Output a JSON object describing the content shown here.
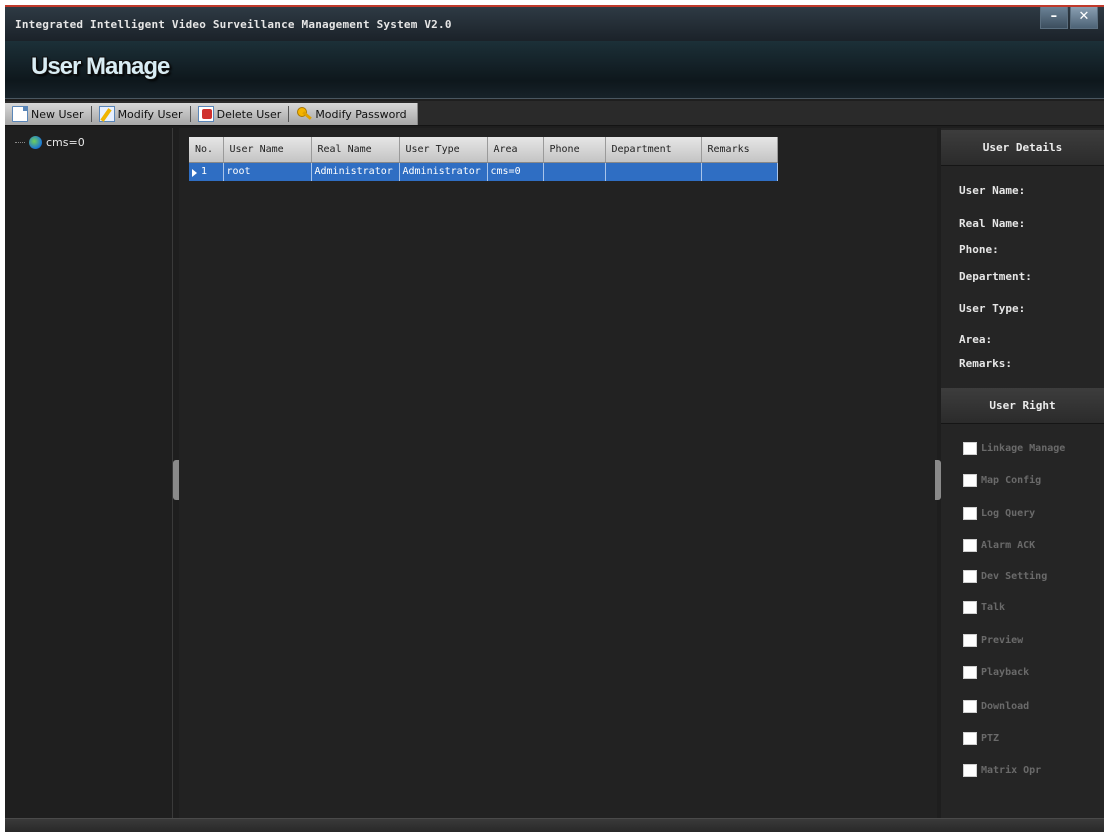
{
  "window": {
    "title": "Integrated Intelligent Video Surveillance Management System V2.0",
    "minimize_label": "–",
    "close_label": "✕"
  },
  "header": {
    "title": "User Manage"
  },
  "toolbar": {
    "new_user": "New User",
    "modify_user": "Modify User",
    "delete_user": "Delete User",
    "modify_password": "Modify Password"
  },
  "tree": {
    "root_label": "cms=0"
  },
  "table": {
    "headers": [
      "No.",
      "User Name",
      "Real Name",
      "User Type",
      "Area",
      "Phone",
      "Department",
      "Remarks"
    ],
    "rows": [
      [
        "1",
        "root",
        "Administrator",
        "Administrator",
        "cms=0",
        "",
        "",
        ""
      ]
    ]
  },
  "details": {
    "title": "User Details",
    "user_name": "User Name:",
    "real_name": "Real Name:",
    "phone": "Phone:",
    "department": "Department:",
    "user_type": "User Type:",
    "area": "Area:",
    "remarks": "Remarks:"
  },
  "rights": {
    "title": "User Right",
    "items": [
      "Linkage Manage",
      "Map Config",
      "Log Query",
      "Alarm ACK",
      "Dev Setting",
      "Talk",
      "Preview",
      "Playback",
      "Download",
      "PTZ",
      "Matrix Opr"
    ]
  },
  "colors": {
    "title_accent": "#c0392b",
    "selection": "#2f6ec3",
    "background": "#1e1e1e"
  }
}
